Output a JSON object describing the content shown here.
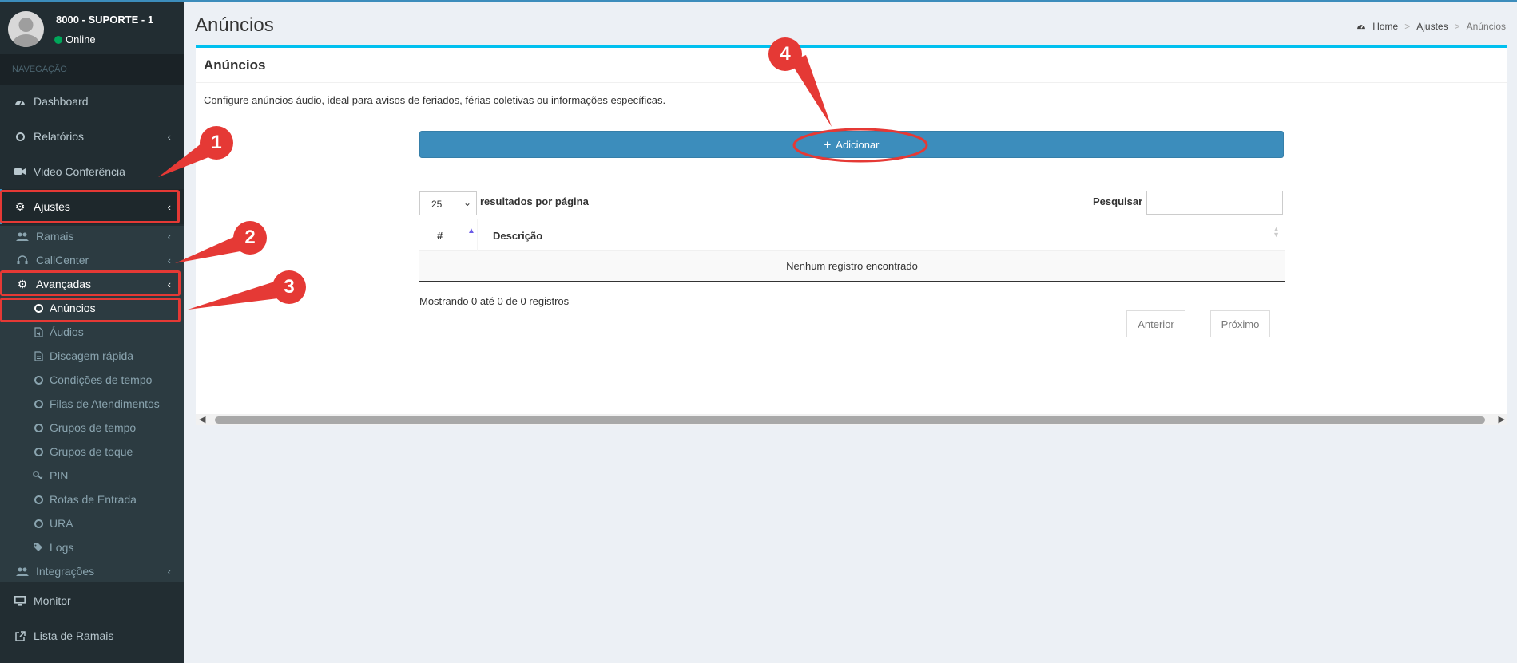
{
  "user": {
    "name": "8000 - SUPORTE - 1",
    "status": "Online"
  },
  "nav": {
    "header": "NAVEGAÇÃO",
    "dashboard": "Dashboard",
    "relatorios": "Relatórios",
    "video": "Video Conferência",
    "ajustes": "Ajustes",
    "ramais": "Ramais",
    "callcenter": "CallCenter",
    "avancadas": "Avançadas",
    "anuncios": "Anúncios",
    "audios": "Áudios",
    "discagem": "Discagem rápida",
    "condicoes": "Condições de tempo",
    "filas": "Filas de Atendimentos",
    "grupos_tempo": "Grupos de tempo",
    "grupos_toque": "Grupos de toque",
    "pin": "PIN",
    "rotas": "Rotas de Entrada",
    "ura": "URA",
    "logs": "Logs",
    "integracoes": "Integrações",
    "monitor": "Monitor",
    "lista_ramais": "Lista de Ramais"
  },
  "page": {
    "title": "Anúncios",
    "breadcrumb": {
      "home": "Home",
      "ajustes": "Ajustes",
      "current": "Anúncios"
    }
  },
  "box": {
    "title": "Anúncios",
    "description": "Configure anúncios áudio, ideal para avisos de feriados, férias coletivas ou informações específicas.",
    "add_label": "Adicionar",
    "page_size": "25",
    "per_page_label": "resultados por página",
    "search_label": "Pesquisar",
    "search_value": "",
    "columns": [
      "#",
      "Descrição"
    ],
    "empty_message": "Nenhum registro encontrado",
    "showing": "Mostrando 0 até 0 de 0 registros",
    "prev": "Anterior",
    "next": "Próximo"
  },
  "annotations": [
    "1",
    "2",
    "3",
    "4"
  ],
  "colors": {
    "accent": "#3c8dbc",
    "sidebar": "#222d32",
    "highlight": "#e53935",
    "box_top": "#00c0ef"
  }
}
